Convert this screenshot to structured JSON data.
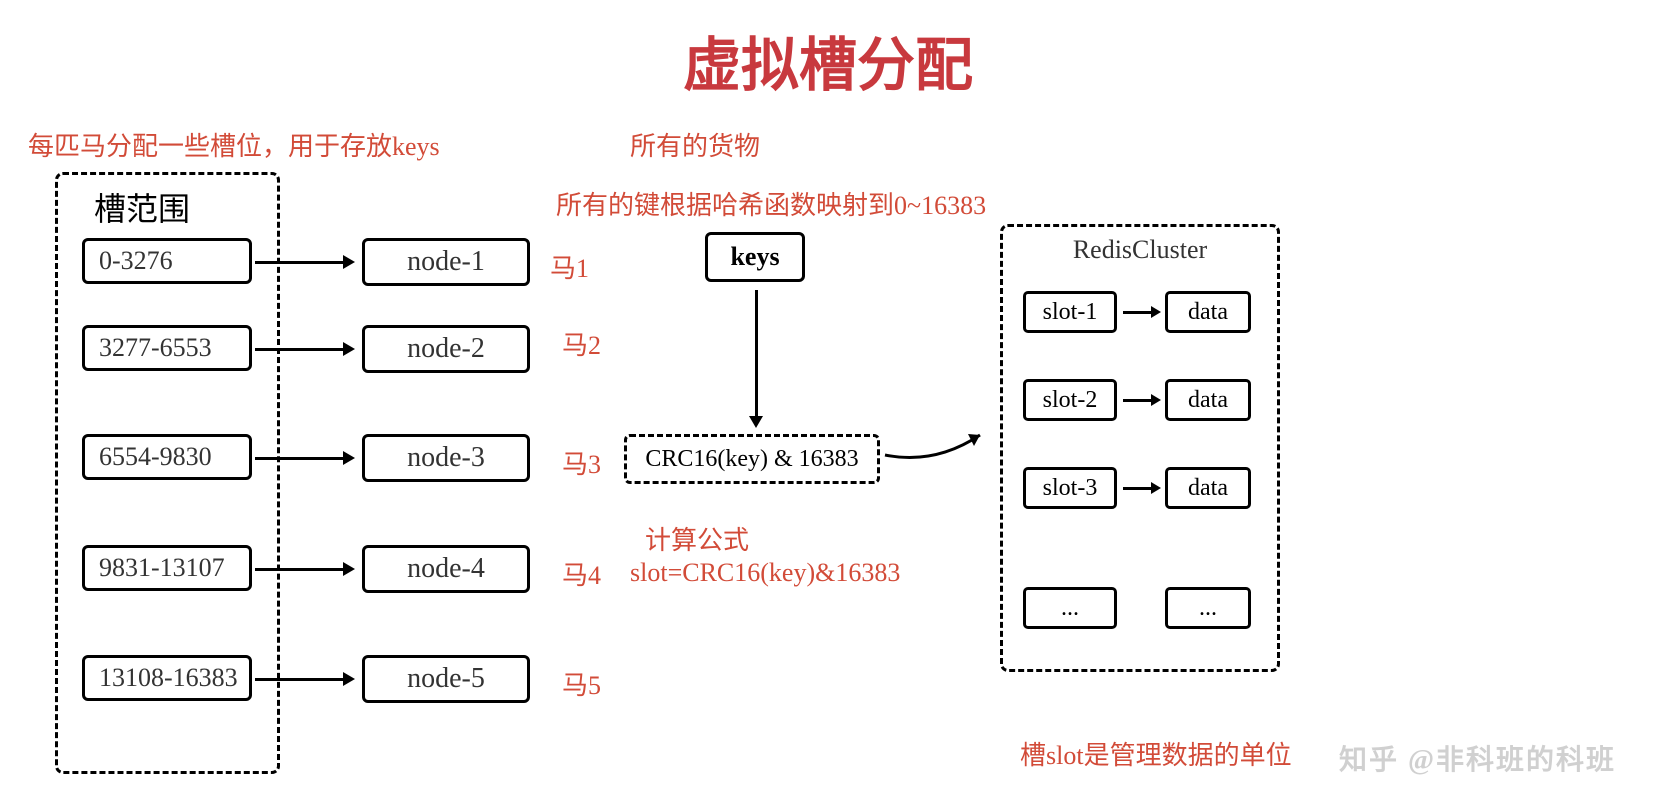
{
  "title": "虚拟槽分配",
  "annotations": {
    "top_left": "每匹马分配一些槽位，用于存放keys",
    "top_mid": "所有的货物",
    "hash_desc": "所有的键根据哈希函数映射到0~16383",
    "formula_label": "计算公式",
    "formula": "slot=CRC16(key)&16383",
    "bottom_right": "槽slot是管理数据的单位"
  },
  "slot_range_header": "槽范围",
  "ranges": [
    {
      "range": "0-3276",
      "node": "node-1",
      "horse": "马1"
    },
    {
      "range": "3277-6553",
      "node": "node-2",
      "horse": "马2"
    },
    {
      "range": "6554-9830",
      "node": "node-3",
      "horse": "马3"
    },
    {
      "range": "9831-13107",
      "node": "node-4",
      "horse": "马4"
    },
    {
      "range": "13108-16383",
      "node": "node-5",
      "horse": "马5"
    }
  ],
  "keys_label": "keys",
  "crc_label": "CRC16(key) & 16383",
  "cluster": {
    "title": "RedisCluster",
    "rows": [
      {
        "slot": "slot-1",
        "data": "data"
      },
      {
        "slot": "slot-2",
        "data": "data"
      },
      {
        "slot": "slot-3",
        "data": "data"
      },
      {
        "slot": "...",
        "data": "..."
      }
    ]
  },
  "watermark": "知乎 @非科班的科班"
}
